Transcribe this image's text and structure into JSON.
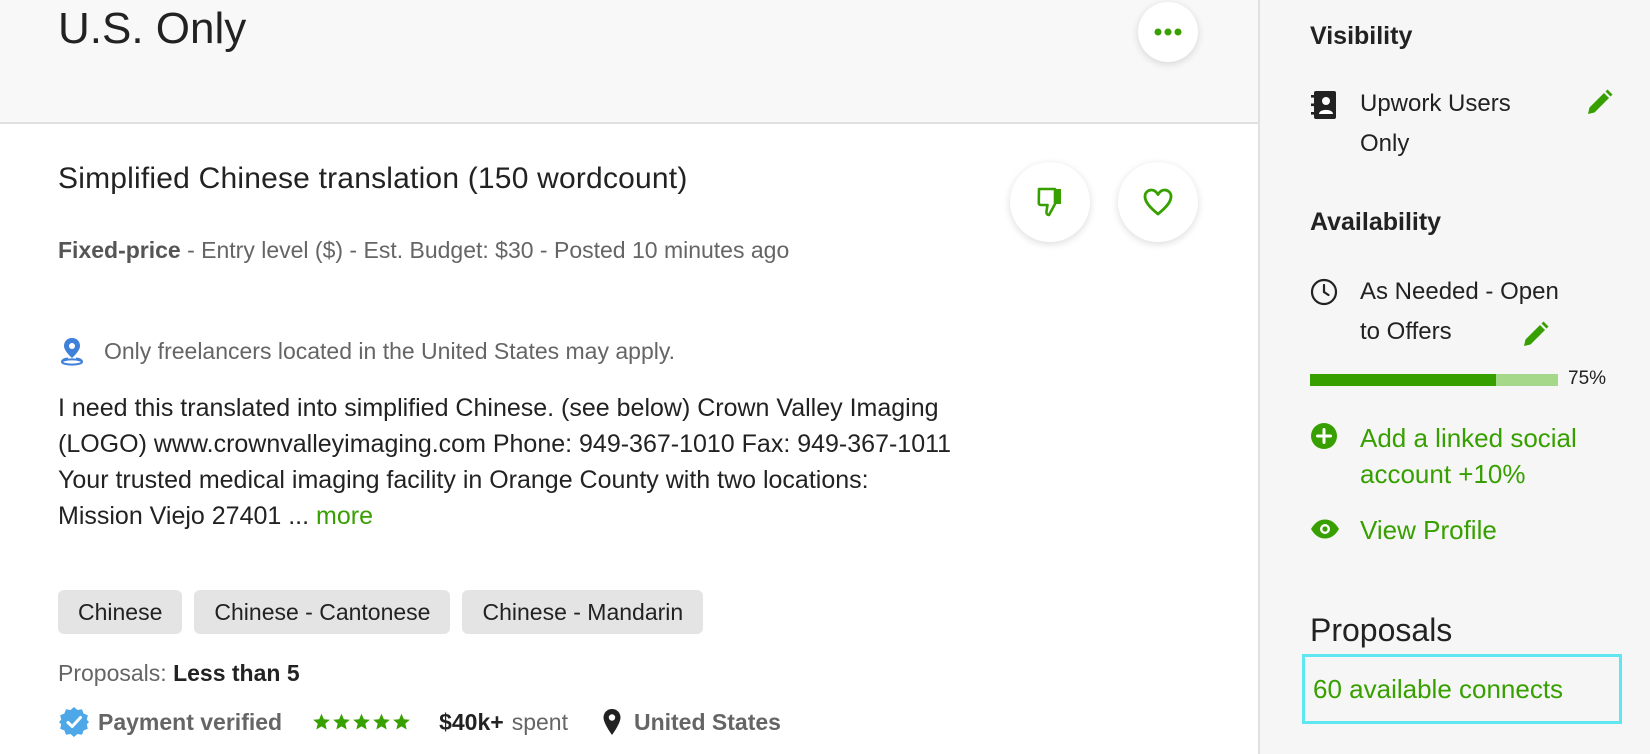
{
  "header": {
    "title": "U.S. Only",
    "more_icon": "more-horizontal-icon"
  },
  "job": {
    "title": "Simplified Chinese translation (150 wordcount)",
    "type": "Fixed-price",
    "meta": " - Entry level ($) - Est. Budget: $30 - Posted 10 minutes ago",
    "location_note": "Only freelancers located in the United States may apply.",
    "description": "I need this translated into simplified Chinese. (see below) Crown Valley Imaging (LOGO) www.crownvalleyimaging.com Phone: 949-367-1010 Fax: 949-367-1011 Your trusted medical imaging facility in Orange County with two locations: Mission Viejo 27401 ...",
    "more_label": "more",
    "tags": [
      "Chinese",
      "Chinese - Cantonese",
      "Chinese - Mandarin"
    ],
    "proposals_label": "Proposals:",
    "proposals_value": "Less than 5",
    "payment_label": "Payment verified",
    "rating": 5,
    "spent_amount": "$40k+",
    "spent_label": "spent",
    "client_country": "United States"
  },
  "sidebar": {
    "visibility": {
      "heading": "Visibility",
      "value_line1": "Upwork Users",
      "value_line2": "Only"
    },
    "availability": {
      "heading": "Availability",
      "value_line1": "As Needed - Open",
      "value_line2": "to Offers"
    },
    "profile_completeness": {
      "percent": 75,
      "label": "75%"
    },
    "add_social": {
      "line1": "Add a linked social",
      "line2": "account +10%"
    },
    "view_profile": "View Profile",
    "proposals": {
      "heading": "Proposals",
      "connects": "60 available connects"
    }
  },
  "colors": {
    "accent": "#37a000",
    "highlight": "#5ee7f0",
    "verified": "#4ea8e8"
  }
}
